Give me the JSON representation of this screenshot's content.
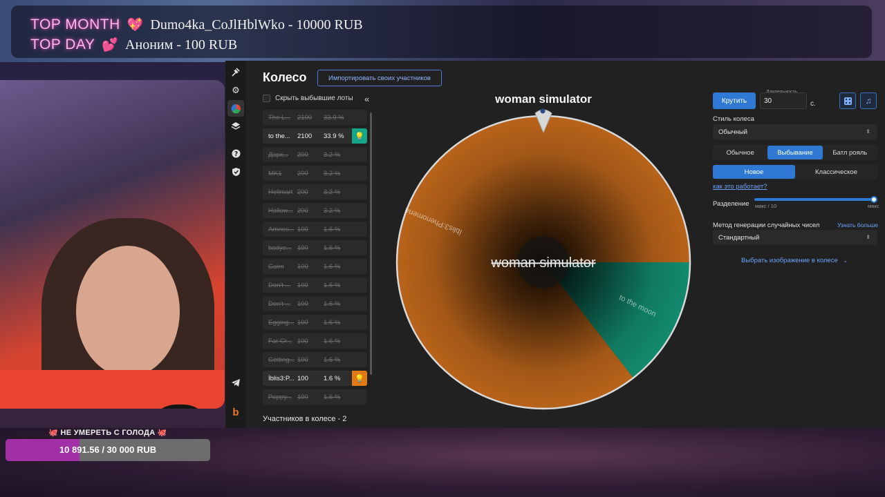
{
  "donations": {
    "top_month_label": "TOP MONTH",
    "top_month_text": "Dumo4ka_CoJlHblWko - 10000 RUB",
    "top_day_label": "TOP DAY",
    "top_day_text": "Аноним - 100 RUB"
  },
  "goal": {
    "title": "🐙 НЕ УМЕРЕТЬ С ГОЛОДА 🐙",
    "progress_text": "10 891.56 / 30 000 RUB",
    "progress_fraction": 0.363
  },
  "app": {
    "title": "Колесо",
    "import_button": "Импортировать своих участников",
    "hide_out_label": "Скрыть выбывшие лоты",
    "participants_label": "Участников в колесе - 2",
    "lots": [
      {
        "name": "The L...",
        "amount": "2100",
        "percent": "33.9 %",
        "state": "out"
      },
      {
        "name": "to the...",
        "amount": "2100",
        "percent": "33.9 %",
        "state": "live",
        "color": "#17a58a"
      },
      {
        "name": "Дарк...",
        "amount": "200",
        "percent": "3.2 %",
        "state": "out"
      },
      {
        "name": "MK1",
        "amount": "200",
        "percent": "3.2 %",
        "state": "out"
      },
      {
        "name": "Hellmart",
        "amount": "200",
        "percent": "3.2 %",
        "state": "out"
      },
      {
        "name": "Hollow...",
        "amount": "200",
        "percent": "3.2 %",
        "state": "out"
      },
      {
        "name": "Amnes...",
        "amount": "100",
        "percent": "1.6 %",
        "state": "out"
      },
      {
        "name": "badye...",
        "amount": "100",
        "percent": "1.6 %",
        "state": "out"
      },
      {
        "name": "Cairn",
        "amount": "100",
        "percent": "1.6 %",
        "state": "out"
      },
      {
        "name": "Don't ...",
        "amount": "100",
        "percent": "1.6 %",
        "state": "out"
      },
      {
        "name": "Don't ...",
        "amount": "100",
        "percent": "1.6 %",
        "state": "out"
      },
      {
        "name": "Egging...",
        "amount": "100",
        "percent": "1.6 %",
        "state": "out"
      },
      {
        "name": "Far Cr...",
        "amount": "100",
        "percent": "1.6 %",
        "state": "out"
      },
      {
        "name": "Getting...",
        "amount": "100",
        "percent": "1.6 %",
        "state": "out"
      },
      {
        "name": "İblis3:P...",
        "amount": "100",
        "percent": "1.6 %",
        "state": "live",
        "color": "#e07a16"
      },
      {
        "name": "Poppy...",
        "amount": "100",
        "percent": "1.6 %",
        "state": "out"
      }
    ]
  },
  "wheel": {
    "winner_title": "woman simulator",
    "center_label": "woman simulator",
    "segments": [
      {
        "label": "İblis3:Phenomena",
        "color": "#b8631a",
        "share": 0.855
      },
      {
        "label": "to the moon",
        "color": "#128a6e",
        "share": 0.145
      }
    ]
  },
  "settings": {
    "spin_button": "Крутить",
    "duration_label": "Длительность",
    "duration_value": "30",
    "duration_unit": "с.",
    "style_label": "Стиль колеса",
    "style_value": "Обычный",
    "mode_tabs": [
      "Обычное",
      "Выбывание",
      "Батл рояль"
    ],
    "mode_active": 1,
    "variant_tabs": [
      "Новое",
      "Классическое"
    ],
    "variant_active": 0,
    "how_link": "как это работает?",
    "split_label": "Разделение",
    "split_min": "макс / 10",
    "split_max": "макс",
    "rng_label": "Метод генерации случайных чисел",
    "rng_link": "Узнать больше",
    "rng_value": "Стандартный",
    "image_link": "Выбрать изображение в колесе"
  }
}
